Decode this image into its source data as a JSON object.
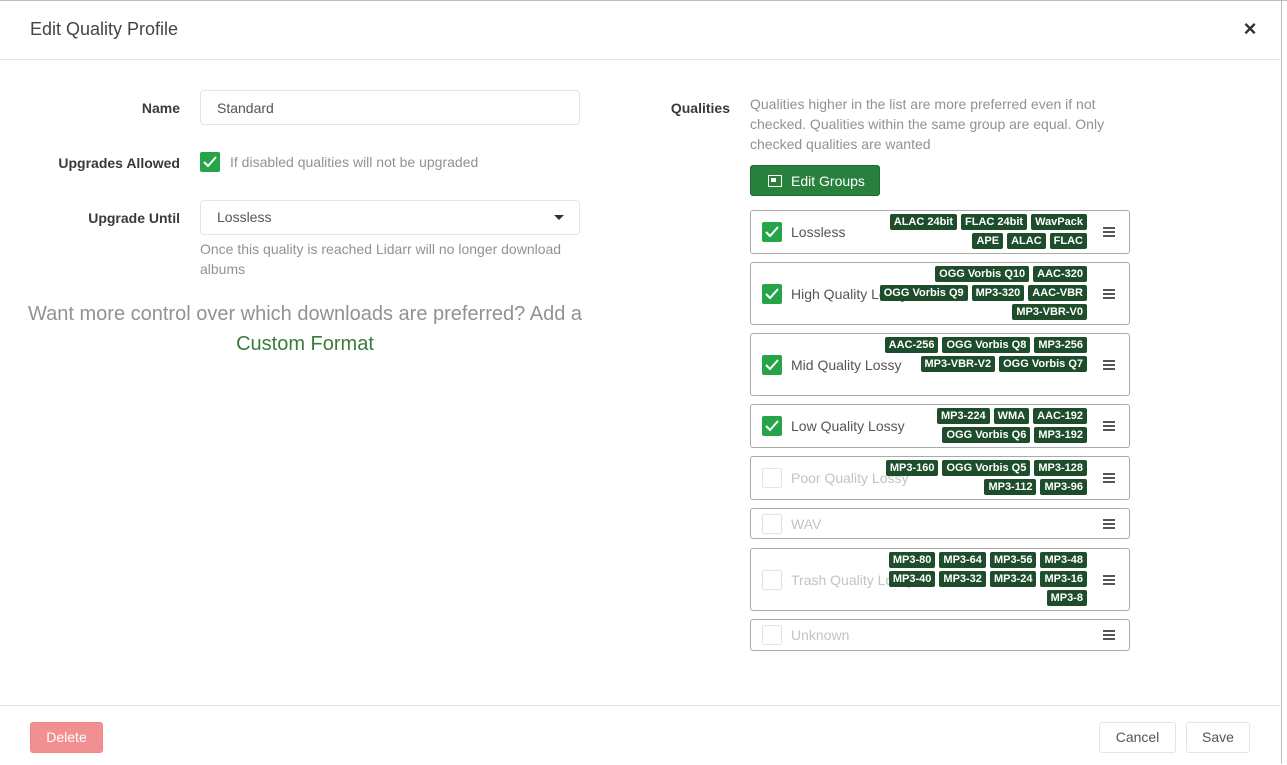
{
  "dialog": {
    "title": "Edit Quality Profile"
  },
  "form": {
    "name_label": "Name",
    "name_value": "Standard",
    "upgrades_label": "Upgrades Allowed",
    "upgrades_checked": true,
    "upgrades_hint": "If disabled qualities will not be upgraded",
    "upgrade_until_label": "Upgrade Until",
    "upgrade_until_value": "Lossless",
    "upgrade_until_hint": "Once this quality is reached Lidarr will no longer download albums",
    "custom_format_text": "Want more control over which downloads are preferred? Add a",
    "custom_format_link": "Custom Format"
  },
  "qualities": {
    "label": "Qualities",
    "description": "Qualities higher in the list are more preferred even if not checked. Qualities within the same group are equal. Only checked qualities are wanted",
    "edit_groups_label": "Edit Groups",
    "items": [
      {
        "name": "Lossless",
        "checked": true,
        "tags": [
          "ALAC 24bit",
          "FLAC 24bit",
          "WavPack",
          "APE",
          "ALAC",
          "FLAC"
        ]
      },
      {
        "name": "High Quality Lossy",
        "checked": true,
        "tags": [
          "OGG Vorbis Q10",
          "AAC-320",
          "OGG Vorbis Q9",
          "MP3-320",
          "AAC-VBR",
          "MP3-VBR-V0"
        ]
      },
      {
        "name": "Mid Quality Lossy",
        "checked": true,
        "tags": [
          "AAC-256",
          "OGG Vorbis Q8",
          "MP3-256",
          "MP3-VBR-V2",
          "OGG Vorbis Q7"
        ]
      },
      {
        "name": "Low Quality Lossy",
        "checked": true,
        "tags": [
          "MP3-224",
          "WMA",
          "AAC-192",
          "OGG Vorbis Q6",
          "MP3-192"
        ]
      },
      {
        "name": "Poor Quality Lossy",
        "checked": false,
        "tags": [
          "MP3-160",
          "OGG Vorbis Q5",
          "MP3-128",
          "MP3-112",
          "MP3-96"
        ]
      },
      {
        "name": "WAV",
        "checked": false,
        "tags": []
      },
      {
        "name": "Trash Quality Lossy",
        "checked": false,
        "tags": [
          "MP3-80",
          "MP3-64",
          "MP3-56",
          "MP3-48",
          "MP3-40",
          "MP3-32",
          "MP3-24",
          "MP3-16",
          "MP3-8"
        ]
      },
      {
        "name": "Unknown",
        "checked": false,
        "tags": []
      }
    ]
  },
  "footer": {
    "delete_label": "Delete",
    "cancel_label": "Cancel",
    "save_label": "Save"
  },
  "colors": {
    "accent": "#27a348",
    "tag_bg": "#1e4d2b",
    "danger": "#f09090",
    "link": "#3a7c3a"
  }
}
